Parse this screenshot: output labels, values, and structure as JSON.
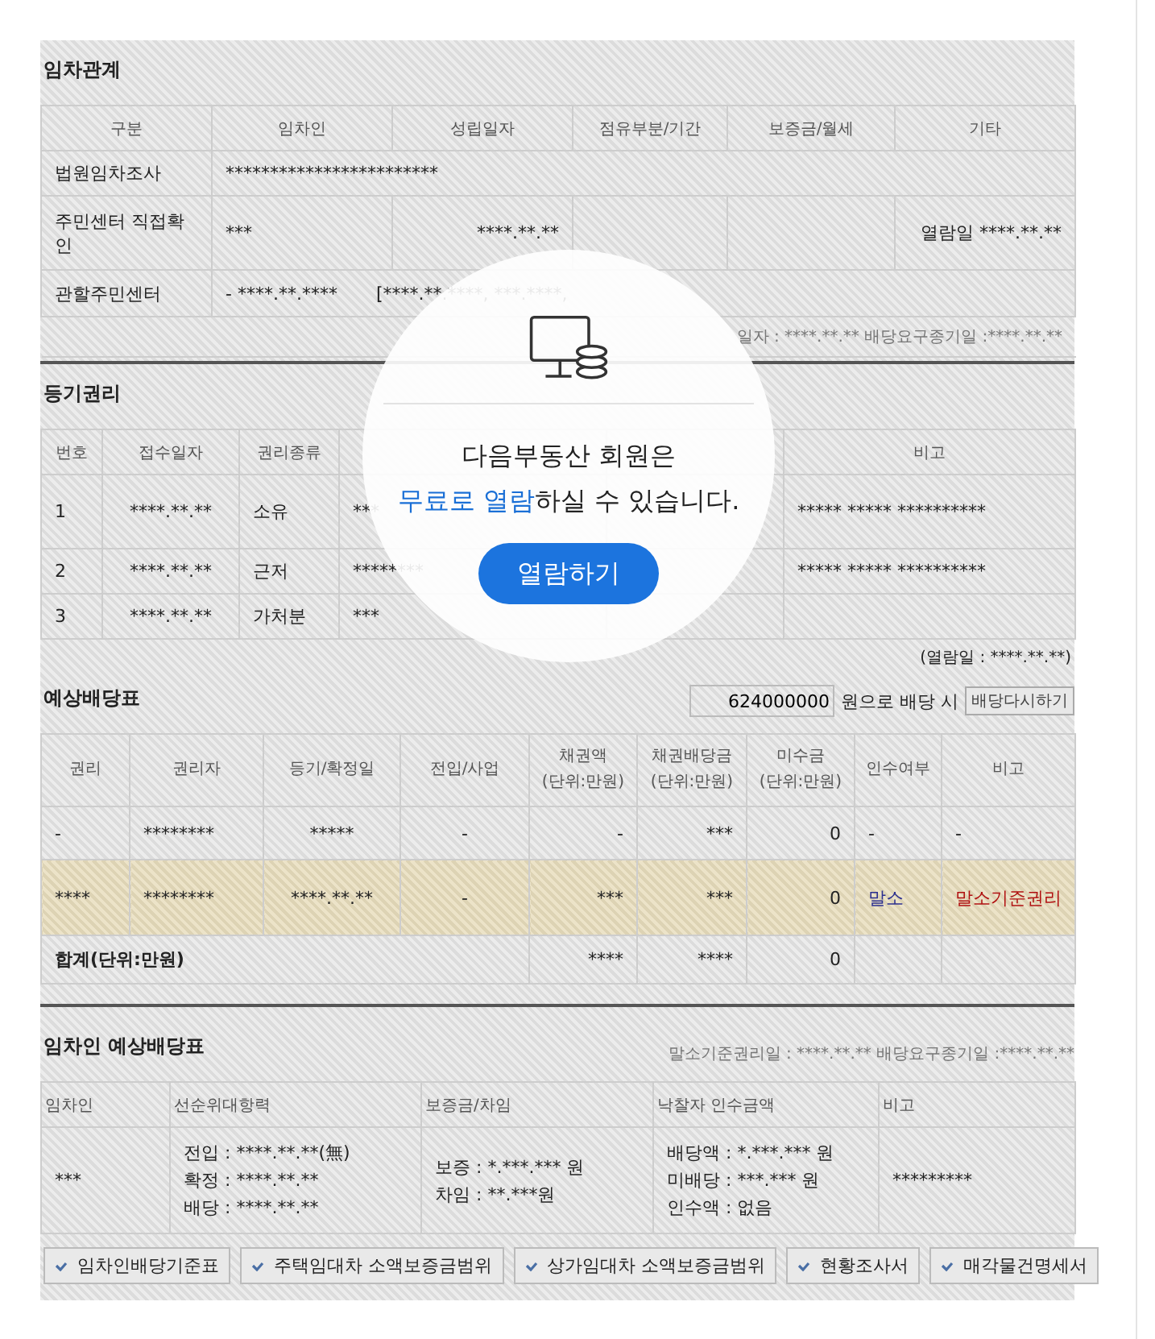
{
  "tenancy": {
    "title": "임차관계",
    "columns": [
      "구분",
      "임차인",
      "성립일자",
      "점유부분/기간",
      "보증금/월세",
      "기타"
    ],
    "court_survey": {
      "label": "법원임차조사",
      "value": "************************"
    },
    "direct_check": {
      "label": "주민센터 직접확인",
      "tenant": "***",
      "date": "****.**.**",
      "other": "열람일 ****.**.**"
    },
    "district_center": {
      "label": "관할주민센터",
      "value": "- ****.**.****",
      "detail": "[****.**.****, ***.****,"
    },
    "note": "일자 : ****.**.** 배당요구종기일 :****.**.**"
  },
  "registry": {
    "title": "등기권리",
    "columns": [
      "번호",
      "접수일자",
      "권리종류"
    ],
    "remarks_header": "비고",
    "rows": [
      {
        "no": "1",
        "date": "****.**.**",
        "type": "소유",
        "holder": "***",
        "remarks": "***** ***** **********"
      },
      {
        "no": "2",
        "date": "****.**.**",
        "type": "근저",
        "holder": "********",
        "remarks": "***** ***** **********"
      },
      {
        "no": "3",
        "date": "****.**.**",
        "type": "가처분",
        "holder": "***"
      }
    ],
    "viewed": "(열람일 : ****.**.**)"
  },
  "distribution": {
    "title": "예상배당표",
    "amount": "624000000",
    "amount_suffix": "원으로 배당 시",
    "redo_button": "배당다시하기",
    "columns": [
      {
        "label": "권리"
      },
      {
        "label": "권리자"
      },
      {
        "label": "등기/확정일"
      },
      {
        "label": "전입/사업"
      },
      {
        "label": "채권액",
        "sub": "(단위:만원)"
      },
      {
        "label": "채권배당금",
        "sub": "(단위:만원)"
      },
      {
        "label": "미수금",
        "sub": "(단위:만원)"
      },
      {
        "label": "인수여부"
      },
      {
        "label": "비고"
      }
    ],
    "rows": [
      {
        "highlighted": false,
        "cells": [
          "-",
          "********",
          "*****",
          "-",
          "-",
          "***",
          "0",
          "-",
          "-"
        ]
      },
      {
        "highlighted": true,
        "cells": [
          "****",
          "********",
          "****.**.**",
          "-",
          "***",
          "***",
          "0",
          "말소",
          "말소기준권리"
        ]
      }
    ],
    "total": {
      "label": "합계(단위:만원)",
      "claim": "****",
      "dividend": "****",
      "unpaid": "0"
    }
  },
  "tenant_distribution": {
    "title": "임차인 예상배당표",
    "note": "말소기준권리일 : ****.**.** 배당요구종기일 :****.**.**",
    "columns": [
      "임차인",
      "선순위대항력",
      "보증금/차임",
      "낙찰자 인수금액",
      "비고"
    ],
    "rows": [
      {
        "tenant": "***",
        "priority": [
          "전입 : ****.**.**(無)",
          "확정 : ****.**.**",
          "배당 : ****.**.**"
        ],
        "deposit": [
          "보증 : *.***.*** 원",
          "차임 : **.***원"
        ],
        "buyer_amount": [
          "배당액 : *.***.*** 원",
          "미배당 : ***.*** 원",
          "인수액 : 없음"
        ],
        "remarks": "*********"
      }
    ]
  },
  "buttons": [
    "임차인배당기준표",
    "주택임대차 소액보증금범위",
    "상가임대차 소액보증금범위",
    "현황조사서",
    "매각물건명세서"
  ],
  "overlay": {
    "line1": "다음부동산 회원은",
    "highlight": "무료로 열람",
    "rest": "하실 수 있습니다.",
    "button": "열람하기"
  }
}
